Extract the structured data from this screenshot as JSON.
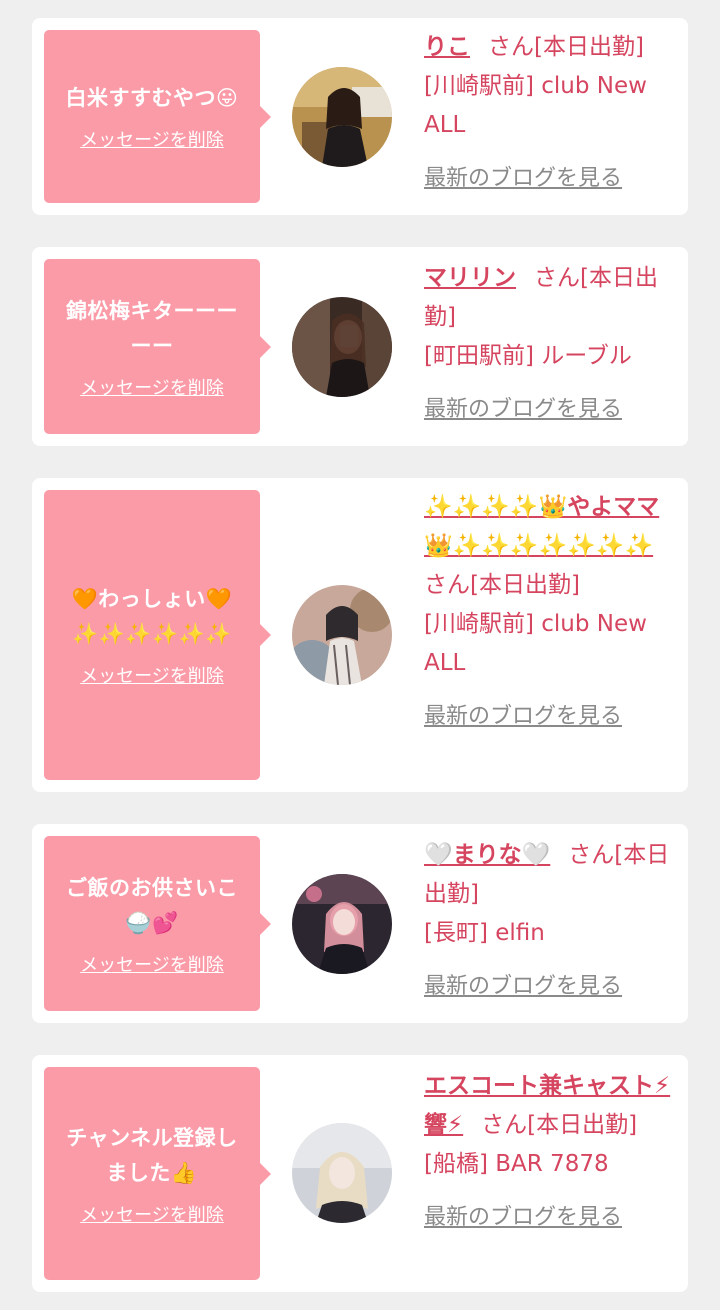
{
  "delete_label": "メッセージを削除",
  "blog_label": "最新のブログを見る",
  "san_label": "さん[本日出勤]",
  "cards": [
    {
      "message": "白米すすむやつ😛",
      "cast_name": "りこ",
      "shop": "[川崎駅前] club New ALL"
    },
    {
      "message": "錦松梅キターーーーー",
      "cast_name": "マリリン",
      "shop": "[町田駅前] ルーブル"
    },
    {
      "message": "🧡わっしょい🧡\n✨✨✨✨✨✨",
      "cast_name": "✨✨✨✨👑やよママ👑✨✨✨✨✨✨✨",
      "shop": "[川崎駅前] club New ALL"
    },
    {
      "message": "ご飯のお供さいこ🍚💕",
      "cast_name": "🤍まりな🤍",
      "shop": "[長町] elfin"
    },
    {
      "message": "チャンネル登録しました👍",
      "cast_name": "エスコート兼キャスト⚡響⚡",
      "shop": "[船橋] BAR 7878"
    }
  ],
  "colors": {
    "bubble": "#fb9ba8",
    "accent": "#d6455f",
    "link_gray": "#8a8a8a",
    "background": "#efefef"
  }
}
